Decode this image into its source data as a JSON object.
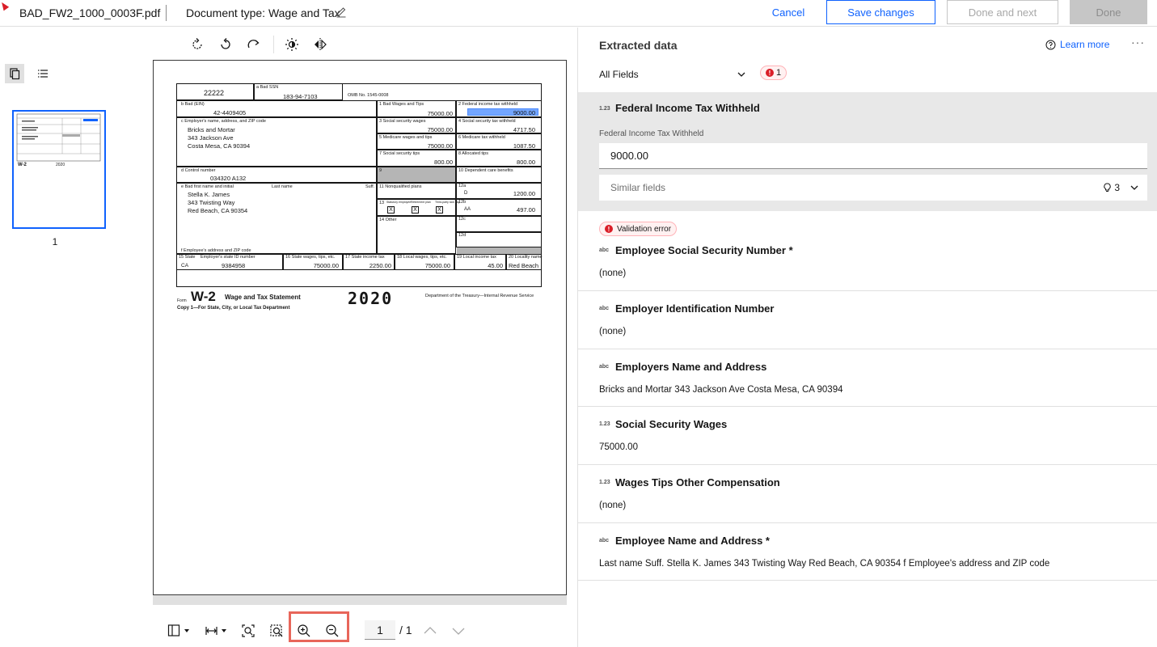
{
  "header": {
    "filename": "BAD_FW2_1000_0003F.pdf",
    "document_type": "Document type: Wage and Tax",
    "cancel_label": "Cancel",
    "save_label": "Save changes",
    "done_next_label": "Done and next",
    "done_label": "Done"
  },
  "thumbnails": {
    "page_label": "1"
  },
  "viewer": {
    "page_current": "1",
    "page_total": "/ 1"
  },
  "w2": {
    "box_a_ssn_label": "a Bad SSN",
    "ssn": "183-94-7103",
    "code_22222": "22222",
    "omb": "OMB No. 1545-0008",
    "ein_label": "b Bad (EIN)",
    "ein": "42-4409405",
    "employer_label": "c Employer's name, address, and ZIP code",
    "employer_line1": "Bricks and Mortar",
    "employer_line2": "343 Jackson Ave",
    "employer_line3": "Costa Mesa, CA 90394",
    "control_label": "d Control number",
    "control": "034320 A132",
    "employee_label": "e Bad first name and initial",
    "last_name_label": "Last name",
    "suff_label": "Suff.",
    "employee_line1": "Stella K. James",
    "employee_line2": "343 Twisting  Way",
    "employee_line3": "Red Beach, CA 90354",
    "employee_addr_label": "f Employee's address and ZIP code",
    "b1_label": "1  Bad Wages and Tips",
    "b1": "75000.00",
    "b2_label": "2  Federal income tax withheld",
    "b2": "9000.00",
    "b3_label": "3  Social security wages",
    "b3": "75000.00",
    "b4_label": "4  Social security tax withheld",
    "b4": "4717.50",
    "b5_label": "5  Medicare wages and tips",
    "b5": "75000.00",
    "b6_label": "6  Medicare tax withheld",
    "b6": "1087.50",
    "b7_label": "7  Social security tips",
    "b7": "800.00",
    "b8_label": "8  Allocated tips",
    "b8": "800.00",
    "b9_label": "9",
    "b10_label": "10  Dependent care benefits",
    "b11_label": "11  Nonqualified plans",
    "b12a_label": "12a",
    "b12a_code": "D",
    "b12a": "1200.00",
    "b12b_label": "12b",
    "b12b_code": "AA",
    "b12b": "497.00",
    "b12c_label": "12c",
    "b12d_label": "12d",
    "b13_label": "13",
    "b13_statutory": "Statutory employee",
    "b13_retirement": "Retirement plan",
    "b13_thirdparty": "Third-party sick pay",
    "b14_label": "14  Other",
    "chk_mark": "X",
    "b15_label": "15 State",
    "b15_id_label": "Employer's state ID number",
    "state": "CA",
    "state_id": "9384958",
    "b16_label": "16 State wages, tips, etc.",
    "b16": "75000.00",
    "b17_label": "17 State income tax",
    "b17": "2250.00",
    "b18_label": "18 Local wages, tips, etc.",
    "b18": "75000.00",
    "b19_label": "19 Local income tax",
    "b19": "45.00",
    "b20_label": "20 Locality name",
    "b20": "Red Beach",
    "form_label": "Form",
    "form_name": "W-2",
    "form_title": "Wage and Tax Statement",
    "year": "2020",
    "treasury": "Department of the Treasury—Internal Revenue Service",
    "copy_label": "Copy 1—For State, City, or Local Tax Department"
  },
  "panel": {
    "title": "Extracted data",
    "learn_more": "Learn more",
    "more": "···",
    "filter_value": "All Fields",
    "error_count": "1",
    "selected_field": {
      "type": "1.23",
      "title": "Federal Income Tax Withheld",
      "sub_label": "Federal Income Tax Withheld",
      "value": "9000.00",
      "similar_label": "Similar fields",
      "similar_count": "3"
    },
    "validation_error_label": "Validation error",
    "fields": [
      {
        "type": "abc",
        "title": "Employee Social Security Number *",
        "value": "(none)"
      },
      {
        "type": "abc",
        "title": "Employer Identification Number",
        "value": "(none)"
      },
      {
        "type": "abc",
        "title": "Employers Name and Address",
        "value": "Bricks and Mortar 343 Jackson Ave Costa Mesa, CA 90394"
      },
      {
        "type": "1.23",
        "title": "Social Security Wages",
        "value": "75000.00"
      },
      {
        "type": "1.23",
        "title": "Wages Tips Other Compensation",
        "value": "(none)"
      },
      {
        "type": "abc",
        "title": "Employee Name and Address *",
        "value": "Last name Suff. Stella K. James 343 Twisting Way Red Beach, CA 90354 f Employee's address and ZIP code"
      }
    ]
  },
  "colors": {
    "accent": "#0f62fe",
    "error": "#da1e28",
    "highlight_box": "#e8665a"
  }
}
